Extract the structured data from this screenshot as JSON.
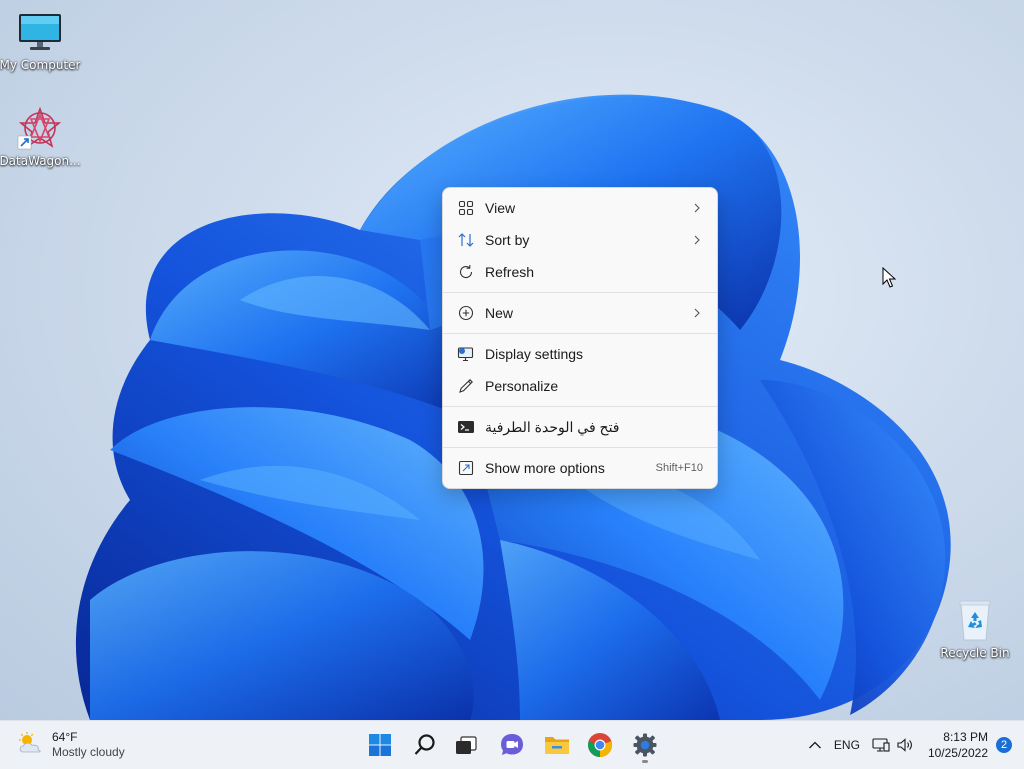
{
  "desktop": {
    "icons": [
      {
        "label": "My Computer",
        "icon": "monitor-icon"
      },
      {
        "label": "DataWagon...",
        "icon": "datawagon-icon"
      },
      {
        "label": "Recycle Bin",
        "icon": "recycle-bin-icon"
      }
    ]
  },
  "context_menu": {
    "items": [
      {
        "label": "View",
        "icon": "view-grid-icon",
        "submenu": true
      },
      {
        "label": "Sort by",
        "icon": "sort-icon",
        "submenu": true
      },
      {
        "label": "Refresh",
        "icon": "refresh-icon"
      },
      {
        "label": "New",
        "icon": "new-plus-icon",
        "submenu": true
      },
      {
        "label": "Display settings",
        "icon": "display-settings-icon"
      },
      {
        "label": "Personalize",
        "icon": "pen-icon"
      },
      {
        "label": "فتح في الوحدة الطرفية",
        "icon": "terminal-icon"
      },
      {
        "label": "Show more options",
        "icon": "more-options-icon",
        "shortcut": "Shift+F10"
      }
    ]
  },
  "taskbar": {
    "weather": {
      "temp": "64°F",
      "condition": "Mostly cloudy",
      "icon": "cloudy-sun-icon"
    },
    "apps": [
      {
        "name": "start-button",
        "icon": "windows-logo-icon"
      },
      {
        "name": "search-button",
        "icon": "search-icon"
      },
      {
        "name": "task-view-button",
        "icon": "task-view-icon"
      },
      {
        "name": "chat-button",
        "icon": "chat-icon"
      },
      {
        "name": "file-explorer-button",
        "icon": "folder-icon"
      },
      {
        "name": "chrome-button",
        "icon": "chrome-icon"
      },
      {
        "name": "settings-button",
        "icon": "gear-icon"
      }
    ],
    "tray": {
      "language": "ENG",
      "time": "8:13 PM",
      "date": "10/25/2022",
      "notifications": "2"
    }
  },
  "colors": {
    "accent": "#1a6fd6",
    "bloom_dark": "#0b3bb8",
    "bloom_mid": "#1a6cf0",
    "bloom_light": "#4aa3ff"
  }
}
